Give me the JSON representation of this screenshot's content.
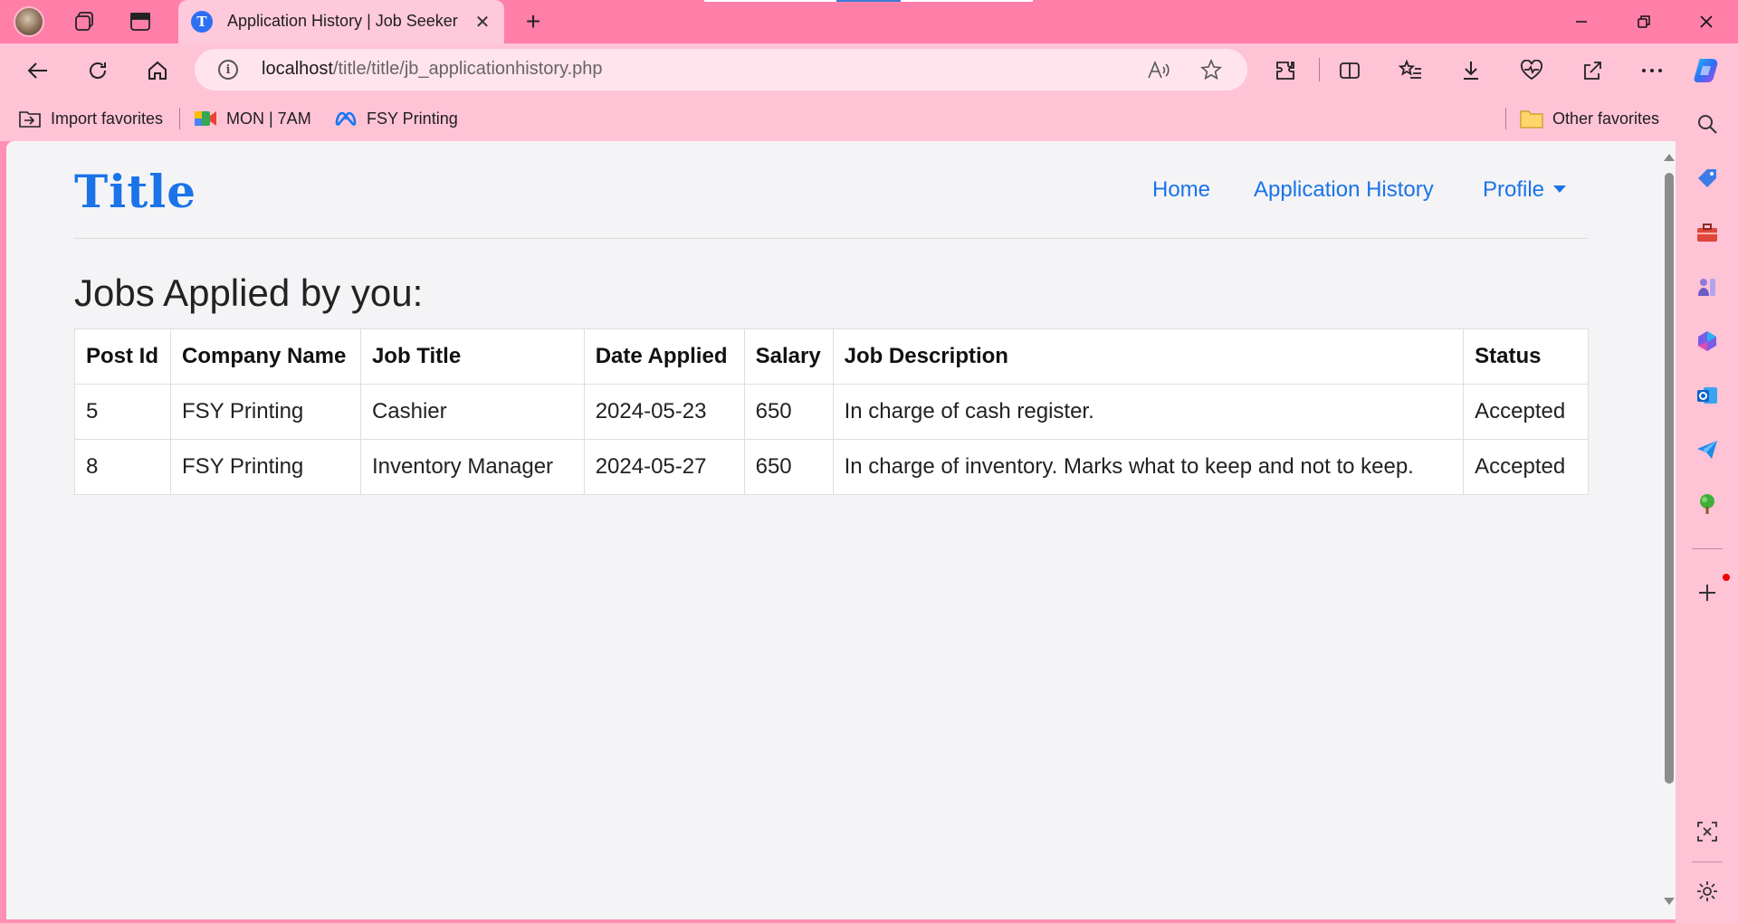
{
  "browser": {
    "tab": {
      "title": "Application History | Job Seeker",
      "favicon_letter": "T"
    },
    "address": {
      "host": "localhost",
      "path": "/title/title/jb_applicationhistory.php"
    },
    "favorites": [
      {
        "label": "Import favorites",
        "icon": "import-icon"
      },
      {
        "label": "MON | 7AM",
        "icon": "meet-icon"
      },
      {
        "label": "FSY Printing",
        "icon": "meta-icon"
      }
    ],
    "other_favorites": "Other favorites"
  },
  "page": {
    "logo": "Title",
    "nav": {
      "home": "Home",
      "history": "Application History",
      "profile": "Profile"
    },
    "heading": "Jobs Applied by you:",
    "table": {
      "headers": [
        "Post Id",
        "Company Name",
        "Job Title",
        "Date Applied",
        "Salary",
        "Job Description",
        "Status"
      ],
      "rows": [
        [
          "5",
          "FSY Printing",
          "Cashier",
          "2024-05-23",
          "650",
          "In charge of cash register.",
          "Accepted"
        ],
        [
          "8",
          "FSY Printing",
          "Inventory Manager",
          "2024-05-27",
          "650",
          "In charge of inventory. Marks what to keep and not to keep.",
          "Accepted"
        ]
      ]
    }
  },
  "colors": {
    "accent": "#1a73e8",
    "chrome": "#ffc3d6",
    "tabstrip": "#ff7fa8"
  }
}
